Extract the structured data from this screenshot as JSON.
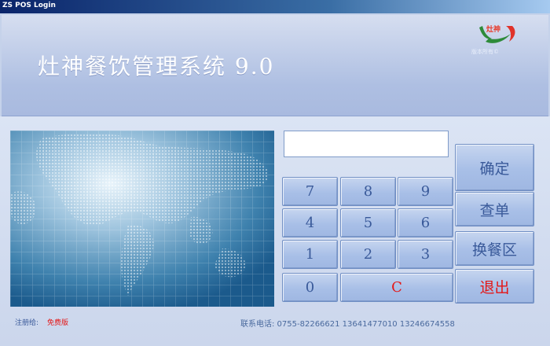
{
  "window": {
    "title": "ZS POS Login"
  },
  "banner": {
    "app_title": "灶神餐饮管理系统 9.0",
    "logo_text": "灶神",
    "copyright": "版本所有©"
  },
  "keypad": {
    "input_value": "",
    "digits": [
      "7",
      "8",
      "9",
      "4",
      "5",
      "6",
      "1",
      "2",
      "3",
      "0"
    ],
    "clear": "C"
  },
  "actions": {
    "confirm": "确定",
    "query": "查单",
    "switch_area": "换餐区",
    "exit": "退出"
  },
  "footer": {
    "register_label": "注册给:",
    "register_value": "免费版",
    "contact": "联系电话: 0755-82266621  13641477010  13246674558"
  },
  "colors": {
    "title_bar": "#0a246a",
    "button_text": "#3a5a9a",
    "accent_red": "#e41616",
    "background": "#c5d2ea"
  }
}
